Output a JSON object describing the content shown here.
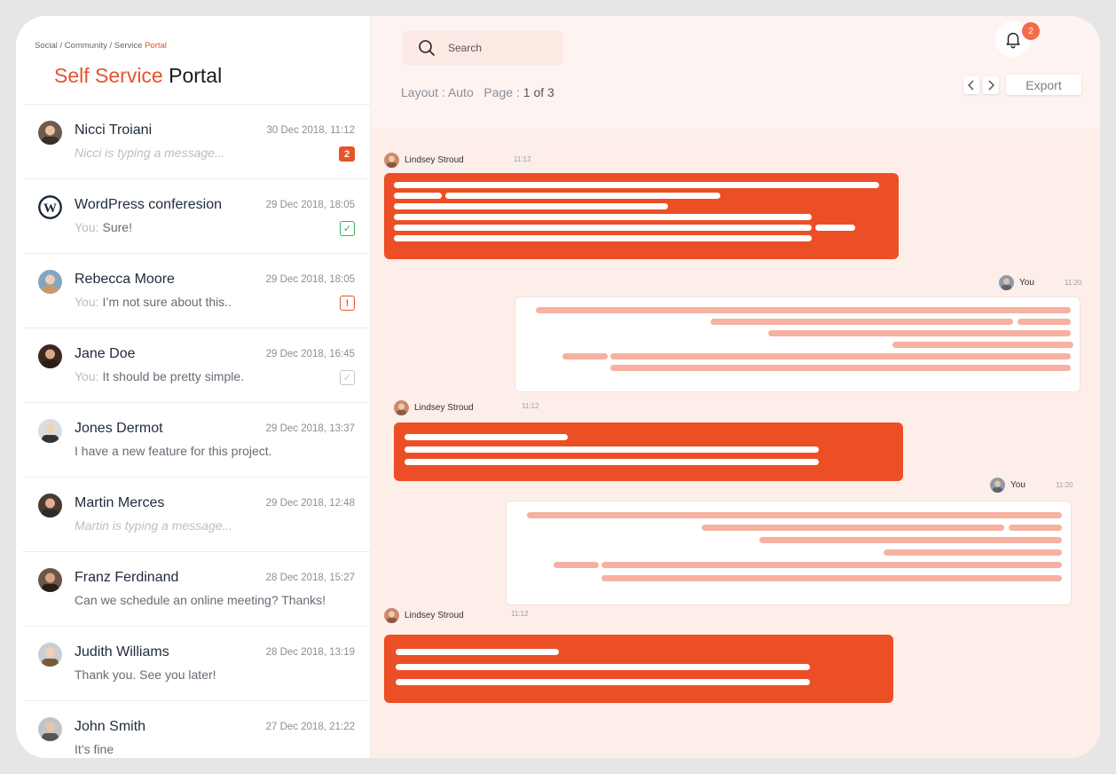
{
  "breadcrumb": {
    "part1": "Social",
    "sep1": " / ",
    "part2": "Community",
    "sep2": " / ",
    "part3": "Service ",
    "active": "Portal"
  },
  "page_title": {
    "accent": "Self Service",
    "rest": " Portal"
  },
  "conversations": [
    {
      "name": "Nicci Troiani",
      "time": "30 Dec 2018, 11:12",
      "you": "",
      "message": "Nicci is typing a message...",
      "typing": true,
      "status": "count",
      "status_text": "2"
    },
    {
      "name": "WordPress conferesion",
      "time": "29 Dec 2018, 18:05",
      "you": "You:",
      "message": "Sure!",
      "typing": false,
      "status": "read",
      "status_text": "✓"
    },
    {
      "name": "Rebecca Moore",
      "time": "29 Dec 2018, 18:05",
      "you": "You:",
      "message": "I’m not sure about this..",
      "typing": false,
      "status": "alert",
      "status_text": "!"
    },
    {
      "name": "Jane Doe",
      "time": "29 Dec 2018, 16:45",
      "you": "You:",
      "message": "It should be pretty simple.",
      "typing": false,
      "status": "sent",
      "status_text": "✓"
    },
    {
      "name": "Jones Dermot",
      "time": "29 Dec 2018, 13:37",
      "you": "",
      "message": "I have a new feature for this project.",
      "typing": false,
      "status": "",
      "status_text": ""
    },
    {
      "name": "Martin Merces",
      "time": "29 Dec 2018, 12:48",
      "you": "",
      "message": "Martin is typing a message...",
      "typing": true,
      "status": "",
      "status_text": ""
    },
    {
      "name": "Franz Ferdinand",
      "time": "28 Dec 2018, 15:27",
      "you": "",
      "message": "Can we schedule an online meeting? Thanks!",
      "typing": false,
      "status": "",
      "status_text": ""
    },
    {
      "name": "Judith Williams",
      "time": "28 Dec 2018, 13:19",
      "you": "",
      "message": "Thank you. See you later!",
      "typing": false,
      "status": "",
      "status_text": ""
    },
    {
      "name": "John Smith",
      "time": "27 Dec 2018, 21:22",
      "you": "",
      "message": "It’s fine",
      "typing": false,
      "status": "",
      "status_text": ""
    }
  ],
  "search": {
    "placeholder": "Search",
    "icon": "search-icon"
  },
  "layout_info": {
    "layout_label": "Layout : ",
    "layout_value": "Auto",
    "page_label": "Page : ",
    "page_value": "1 of 3"
  },
  "notifications": {
    "icon": "bell-icon",
    "count": "2"
  },
  "export_label": "Export",
  "messages": [
    {
      "sender": "Lindsey Stroud",
      "time": "11:12",
      "direction": "in"
    },
    {
      "sender": "You",
      "time": "11:20",
      "direction": "out"
    },
    {
      "sender": "Lindsey Stroud",
      "time": "11:12",
      "direction": "in"
    },
    {
      "sender": "You",
      "time": "11:20",
      "direction": "out"
    },
    {
      "sender": "Lindsey Stroud",
      "time": "11:12",
      "direction": "in"
    }
  ],
  "colors": {
    "accent": "#e8532a",
    "bubble_in": "#ec4f25",
    "bubble_out_line": "#f7b1a0",
    "chat_bg": "#fdeeea"
  }
}
